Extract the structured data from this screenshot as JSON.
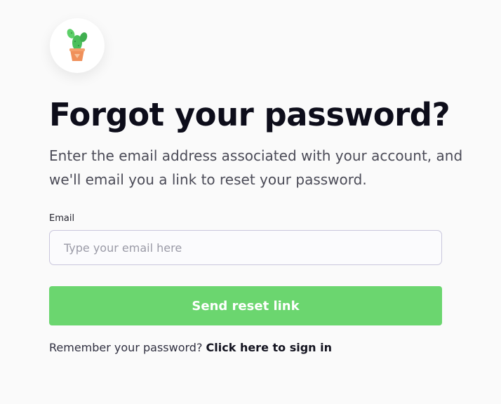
{
  "logo": {
    "icon": "cactus-icon"
  },
  "heading": "Forgot your password?",
  "subtitle": "Enter the email address associated with your account, and we'll email you a link to reset your password.",
  "form": {
    "email_label": "Email",
    "email_placeholder": "Type your email here",
    "email_value": "",
    "submit_label": "Send reset link"
  },
  "footer": {
    "prompt": "Remember your password? ",
    "signin_link": "Click here to sign in"
  },
  "colors": {
    "accent": "#6bd66f",
    "background": "#fafafa",
    "text": "#0d0d1a"
  }
}
